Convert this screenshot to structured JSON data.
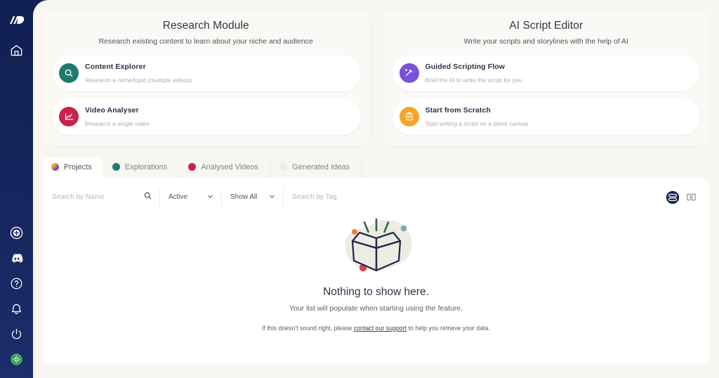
{
  "sidebar": {
    "top_items": [
      {
        "name": "logo",
        "label": "Brand Logo"
      },
      {
        "name": "home-icon",
        "label": "Home"
      }
    ],
    "bottom_items": [
      {
        "name": "add-circle-icon",
        "label": "Create New"
      },
      {
        "name": "discord-icon",
        "label": "Discord"
      },
      {
        "name": "help-circle-icon",
        "label": "Help"
      },
      {
        "name": "bell-icon",
        "label": "Notifications"
      },
      {
        "name": "power-icon",
        "label": "Log out"
      },
      {
        "name": "status-badge-icon",
        "label": "Status"
      }
    ]
  },
  "modules": [
    {
      "title": "Research Module",
      "subtitle": "Research existing content to learn about your niche and audience",
      "options": [
        {
          "name": "Content Explorer",
          "desc": "Research a niche/topic (multiple videos)",
          "icon": "search-icon",
          "color": "#1d7a6e"
        },
        {
          "name": "Video Analyser",
          "desc": "Research a single video",
          "icon": "chart-line-icon",
          "color": "#c9234a"
        }
      ]
    },
    {
      "title": "AI Script Editor",
      "subtitle": "Write your scripts and storylines with the help of AI",
      "options": [
        {
          "name": "Guided Scripting Flow",
          "desc": "Brief the AI to write the script for you",
          "icon": "magic-wand-icon",
          "color": "#7a52d8"
        },
        {
          "name": "Start from Scratch",
          "desc": "Start writing a script on a blank canvas",
          "icon": "clipboard-icon",
          "color": "#f5a623"
        }
      ]
    }
  ],
  "tabs": [
    {
      "label": "Projects",
      "color": "gradient",
      "active": true
    },
    {
      "label": "Explorations",
      "color": "#1d7a6e",
      "active": false
    },
    {
      "label": "Analysed Videos",
      "color": "#c9234a",
      "active": false
    },
    {
      "label": "Generated Ideas",
      "color": "#efece3",
      "active": false
    }
  ],
  "filters": {
    "search_placeholder": "Search by Name",
    "search_value": "",
    "search_icon": "search-icon",
    "status_select": {
      "value": "Active",
      "icon": "chevron-down-icon"
    },
    "show_select": {
      "value": "Show All",
      "icon": "chevron-down-icon"
    },
    "tag_placeholder": "Search by Tag",
    "tag_value": "",
    "view_list_icon": "list-view-icon",
    "view_grid_icon": "grid-view-icon"
  },
  "empty_state": {
    "illustration": "open-box-icon",
    "heading": "Nothing to show here.",
    "paragraph": "Your list will populate when starting using the feature.",
    "support_prefix": "If this doesn't sound right, please ",
    "support_link": "contact our support",
    "support_suffix": " to help you retrieve your data."
  },
  "colors": {
    "sidebar_bg": "#132157",
    "page_bg": "#f7f6f1",
    "panel_bg": "#ffffff",
    "accent_green": "#1d7a6e",
    "accent_red": "#c9234a",
    "accent_purple": "#7a52d8",
    "accent_orange": "#f5a623",
    "box_outline": "#1f2b52",
    "blob": "#eeece2"
  }
}
